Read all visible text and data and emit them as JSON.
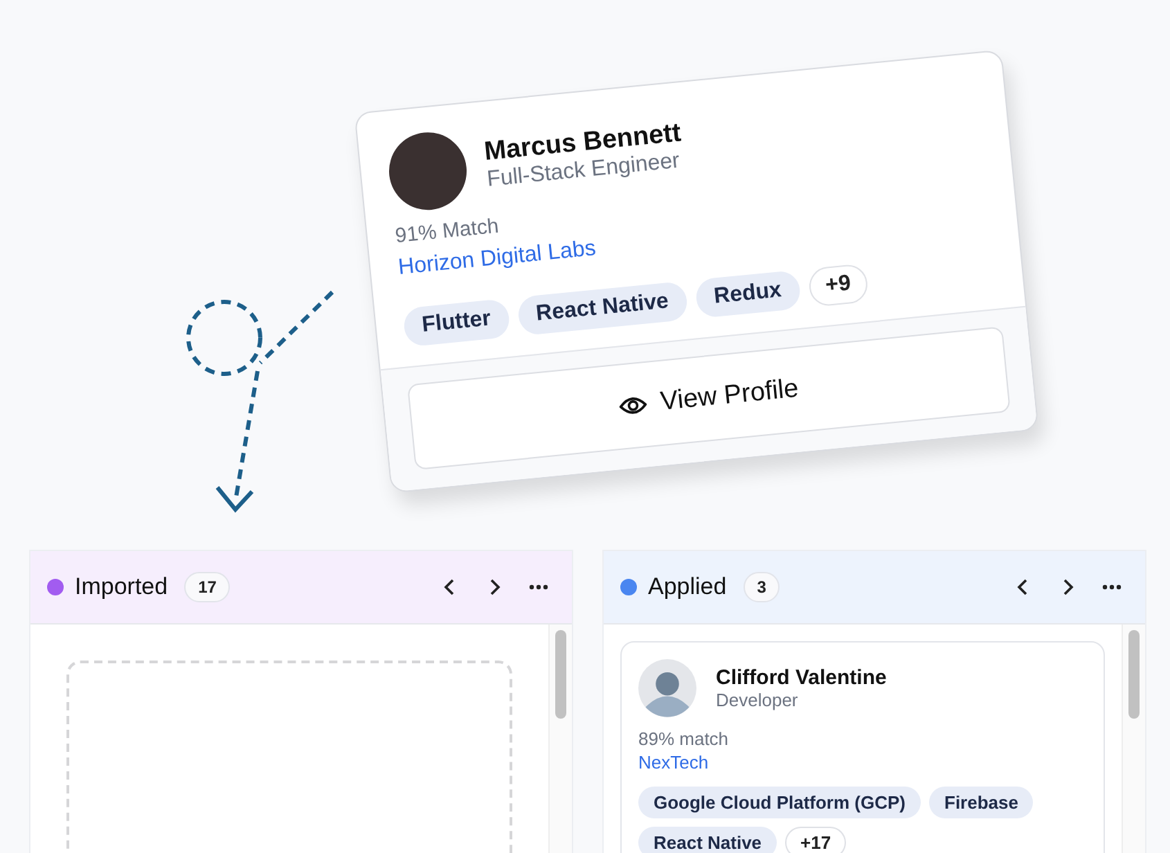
{
  "dragged_card": {
    "name": "Marcus Bennett",
    "role": "Full-Stack Engineer",
    "match": "91% Match",
    "company": "Horizon Digital Labs",
    "tags": [
      "Flutter",
      "React Native",
      "Redux"
    ],
    "more": "+9",
    "action": "View Profile"
  },
  "columns": [
    {
      "title": "Imported",
      "color": "#a25cf0",
      "count": "17",
      "kind": "dropzone"
    },
    {
      "title": "Applied",
      "color": "#4a86f0",
      "count": "3",
      "kind": "cards",
      "cards": [
        {
          "name": "Clifford Valentine",
          "role": "Developer",
          "match": "89% match",
          "company": "NexTech",
          "tags": [
            "Google Cloud Platform (GCP)",
            "Firebase",
            "React Native"
          ],
          "more": "+17"
        }
      ]
    }
  ]
}
